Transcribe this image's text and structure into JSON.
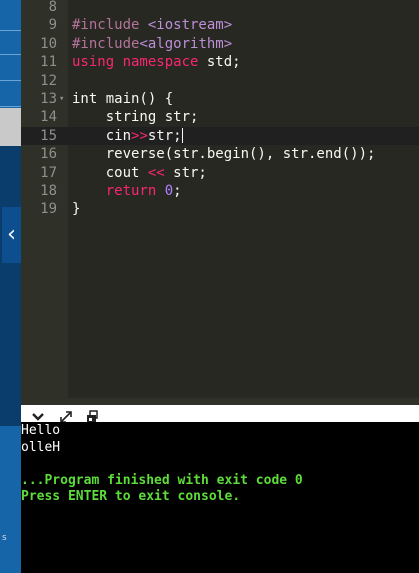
{
  "editor": {
    "lines": [
      {
        "num": "8",
        "segments": []
      },
      {
        "num": "9",
        "segments": [
          {
            "t": "#include ",
            "c": "inc"
          },
          {
            "t": "<iostream>",
            "c": "hdr"
          }
        ]
      },
      {
        "num": "10",
        "segments": [
          {
            "t": "#include",
            "c": "inc"
          },
          {
            "t": "<algorithm>",
            "c": "hdr"
          }
        ]
      },
      {
        "num": "11",
        "segments": [
          {
            "t": "using namespace ",
            "c": "kw"
          },
          {
            "t": "std;",
            "c": "ty"
          }
        ]
      },
      {
        "num": "12",
        "segments": []
      },
      {
        "num": "13",
        "fold": true,
        "segments": [
          {
            "t": "int ",
            "c": "ty"
          },
          {
            "t": "main() {",
            "c": "ty"
          }
        ]
      },
      {
        "num": "14",
        "segments": [
          {
            "t": "    string str;",
            "c": "ty"
          }
        ]
      },
      {
        "num": "15",
        "active": true,
        "segments": [
          {
            "t": "    cin",
            "c": "ty"
          },
          {
            "t": ">>",
            "c": "op"
          },
          {
            "t": "str;",
            "c": "ty"
          }
        ]
      },
      {
        "num": "16",
        "segments": [
          {
            "t": "    reverse(str.begin(), str.end());",
            "c": "ty"
          }
        ]
      },
      {
        "num": "17",
        "segments": [
          {
            "t": "    cout ",
            "c": "ty"
          },
          {
            "t": "<<",
            "c": "op"
          },
          {
            "t": " str;",
            "c": "ty"
          }
        ]
      },
      {
        "num": "18",
        "segments": [
          {
            "t": "    ",
            "c": "ty"
          },
          {
            "t": "return ",
            "c": "kw"
          },
          {
            "t": "0",
            "c": "num"
          },
          {
            "t": ";",
            "c": "ty"
          }
        ]
      },
      {
        "num": "19",
        "segments": [
          {
            "t": "}",
            "c": "ty"
          }
        ]
      }
    ]
  },
  "sidebar": {
    "collapse_glyph": "‹",
    "bottom_glyph": "s"
  },
  "toolbar": {
    "icons": [
      "chevron-down-icon",
      "expand-icon",
      "copy-icon"
    ]
  },
  "console": {
    "lines": [
      {
        "text": "Hello",
        "c": "out"
      },
      {
        "text": "olleH",
        "c": "out"
      },
      {
        "text": "",
        "c": "out"
      },
      {
        "text": "...Program finished with exit code 0",
        "c": "ok"
      },
      {
        "text": "Press ENTER to exit console.",
        "c": "ok"
      }
    ]
  },
  "colors": {
    "editor_bg": "#272822",
    "console_bg": "#000000",
    "success_green": "#5ddc3b",
    "keyword": "#f92672",
    "sidebar_blue": "#1565a8"
  }
}
